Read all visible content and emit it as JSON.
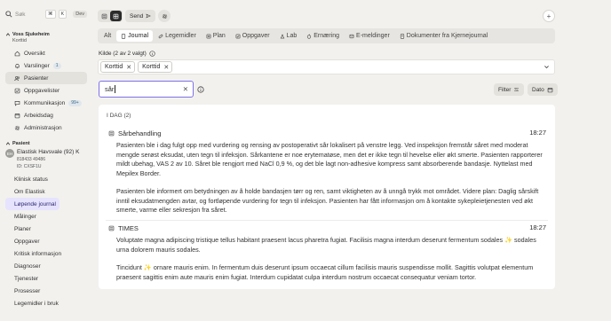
{
  "sidebar": {
    "search_placeholder": "Søk",
    "kbd_cmd": "⌘",
    "kbd_k": "K",
    "dev_label": "Dev",
    "unit_title": "Voss Sjukeheim",
    "unit_sub": "Korttid",
    "items": [
      {
        "label": "Oversikt",
        "icon": "home-icon"
      },
      {
        "label": "Varslinger",
        "icon": "bell-icon",
        "badge": "1"
      },
      {
        "label": "Pasienter",
        "icon": "users-icon",
        "active": true
      },
      {
        "label": "Oppgavelister",
        "icon": "checklist-icon"
      },
      {
        "label": "Kommunikasjon",
        "icon": "chat-icon",
        "badge": "99+"
      },
      {
        "label": "Arbeidsdag",
        "icon": "calendar-icon"
      },
      {
        "label": "Administrasjon",
        "icon": "gear-icon"
      }
    ],
    "patient_head": "Pasient",
    "patient": {
      "initials": "EH",
      "name": "Elastisk Havsvale (92) K",
      "id1": "818433 49486",
      "id2": "ID: CXSF1U"
    },
    "patient_items": [
      "Klinisk status",
      "Om Elastisk",
      "Løpende journal",
      "Målinger",
      "Planer",
      "Oppgaver",
      "Kritisk informasjon",
      "Diagnoser",
      "Tjenester",
      "Prosesser",
      "Legemidler i bruk"
    ]
  },
  "toolbar": {
    "send_label": "Send"
  },
  "tabs": [
    {
      "label": "Alt"
    },
    {
      "label": "Journal",
      "active": true
    },
    {
      "label": "Legemidler"
    },
    {
      "label": "Plan"
    },
    {
      "label": "Oppgaver"
    },
    {
      "label": "Lab"
    },
    {
      "label": "Ernæring"
    },
    {
      "label": "E-meldinger"
    },
    {
      "label": "Dokumenter fra Kjernejournal"
    }
  ],
  "source": {
    "label": "Kilde (2 av 2 valgt)",
    "chips": [
      "Korttid",
      "Korttid"
    ]
  },
  "search": {
    "value": "sår"
  },
  "filter_label": "Filter",
  "date_label": "Dato",
  "day_label": "I DAG (2)",
  "entries": [
    {
      "title": "Sårbehandling",
      "time": "18:27",
      "paragraphs": [
        "Pasienten ble i dag fulgt opp med vurdering og rensing av postoperativt sår lokalisert på venstre legg. Ved inspeksjon fremstår såret med moderat mengde serøst eksudat, uten tegn til infeksjon. Sårkantene er noe erytematøse, men det er ikke tegn til hevelse eller økt smerte. Pasienten rapporterer mildt ubehag, VAS 2 av 10. Såret ble rengjort med NaCl 0,9 %, og det ble lagt non-adhesive kompress samt absorberende bandasje. Nyttelast med Mepilex Border.",
        "Pasienten ble informert om betydningen av å holde bandasjen tørr og ren, samt viktigheten av å unngå trykk mot området. Videre plan: Daglig sårskift inntil eksudatmengden avtar, og fortløpende vurdering for tegn til infeksjon. Pasienten har fått informasjon om å kontakte sykepleietjenesten ved økt smerte, varme eller sekresjon fra såret."
      ]
    },
    {
      "title": "TIMES",
      "time": "18:27",
      "paragraphs": [
        "Voluptate magna adipiscing tristique tellus habitant praesent lacus pharetra fugiat. Facilisis magna interdum deserunt fermentum sodales ✨ sodales urna dolorem mauris sodales.",
        "Tincidunt ✨ ornare mauris enim. In fermentum duis deserunt ipsum occaecat cillum facilisis mauris suspendisse mollit. Sagittis volutpat elementum praesent sagittis enim aute mauris enim fugiat. Interdum cupidatat culpa interdum nostrum occaecat consequatur veniam tortor."
      ]
    }
  ],
  "colors": {
    "accent": "#7d72e8",
    "active_bg": "#e6e3ff",
    "bg": "#f2f1ee"
  }
}
